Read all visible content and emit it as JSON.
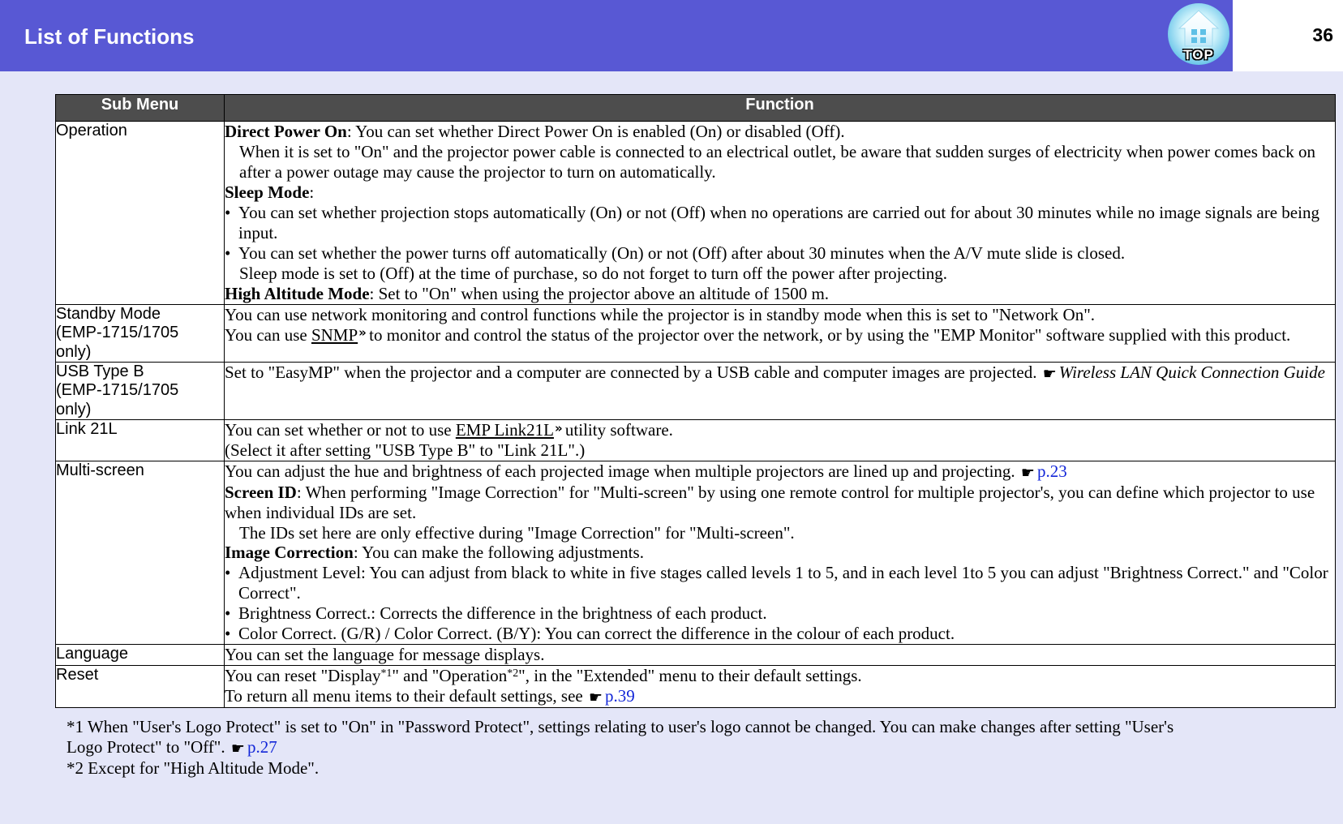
{
  "header": {
    "title": "List of Functions",
    "page_number": "36",
    "top_button_label": "TOP",
    "top_button_icon": "home-icon",
    "bar_color": "#5858d4"
  },
  "table": {
    "columns": [
      "Sub Menu",
      "Function"
    ],
    "rows": [
      {
        "sub_menu": "Operation",
        "blocks": [
          {
            "type": "lead",
            "lead": "Direct Power On",
            "text": ": You can set whether Direct Power On is enabled (On) or disabled (Off)."
          },
          {
            "type": "indent",
            "text": "When it is set to \"On\" and the projector power cable is connected to an electrical outlet, be aware that sudden surges of electricity when power comes back on after a power outage may cause the projector to turn on automatically."
          },
          {
            "type": "lead",
            "lead": "Sleep Mode",
            "text": ":"
          },
          {
            "type": "bullet",
            "text": "You can set whether projection stops automatically (On) or not (Off) when no operations are carried out for about 30 minutes while no image signals are being input."
          },
          {
            "type": "bullet",
            "text": "You can set whether the power turns off automatically (On) or not (Off) after about 30 minutes when the A/V mute slide is closed."
          },
          {
            "type": "indent",
            "text": "Sleep mode is set to (Off) at the time of purchase, so do not forget to turn off the power after projecting."
          },
          {
            "type": "lead",
            "lead": "High Altitude Mode",
            "text": ": Set to \"On\" when using the projector above an altitude of 1500 m."
          }
        ]
      },
      {
        "sub_menu": "Standby Mode\n(EMP-1715/1705\nonly)",
        "blocks": [
          {
            "type": "plain",
            "text": "You can use network monitoring and control functions while the projector is in standby mode when this is set to \"Network On\"."
          },
          {
            "type": "gloss",
            "pre": "You can use ",
            "term": "SNMP",
            "post": " to monitor and control the status of the projector over the network, or by using the \"EMP Monitor\" software supplied with this product."
          }
        ]
      },
      {
        "sub_menu": "USB Type B\n(EMP-1715/1705\nonly)",
        "blocks": [
          {
            "type": "guide",
            "text": "Set to \"EasyMP\" when the projector and a computer are connected by a USB cable and computer images are projected. ",
            "guide_title": "Wireless LAN Quick Connection Guide"
          }
        ]
      },
      {
        "sub_menu": "Link 21L",
        "blocks": [
          {
            "type": "gloss",
            "pre": "You can set whether or not to use ",
            "term": "EMP Link21L",
            "post": " utility software."
          },
          {
            "type": "plain",
            "text": "(Select it after setting \"USB Type B\" to \"Link 21L\".)"
          }
        ]
      },
      {
        "sub_menu": "Multi-screen",
        "blocks": [
          {
            "type": "plink",
            "text": "You can adjust the hue and brightness of each projected image when multiple projectors are lined up and projecting. ",
            "link": "p.23"
          },
          {
            "type": "lead",
            "lead": "Screen ID",
            "text": ": When performing \"Image Correction\" for \"Multi-screen\" by using one remote control for multiple projector's, you can define which projector to use when individual IDs are set."
          },
          {
            "type": "indent",
            "text": "The IDs set here are only effective during \"Image Correction\" for \"Multi-screen\"."
          },
          {
            "type": "lead",
            "lead": "Image Correction",
            "text": ": You can make the following adjustments."
          },
          {
            "type": "bullet",
            "text": "Adjustment Level: You can adjust from black to white in five stages called levels 1 to 5, and in each level 1to 5 you can adjust \"Brightness Correct.\" and \"Color Correct\"."
          },
          {
            "type": "bullet",
            "text": "Brightness Correct.: Corrects the difference in the brightness of each product."
          },
          {
            "type": "bullet",
            "text": "Color Correct. (G/R) / Color Correct. (B/Y): You can correct the difference in the colour of each product."
          }
        ]
      },
      {
        "sub_menu": "Language",
        "blocks": [
          {
            "type": "plain",
            "text": "You can set the language for message displays."
          }
        ]
      },
      {
        "sub_menu": "Reset",
        "blocks": [
          {
            "type": "reset",
            "pre": "You can reset \"Display",
            "sup1": "*1",
            "mid": "\" and \"Operation",
            "sup2": "*2",
            "post": "\", in the \"Extended\" menu to their default settings."
          },
          {
            "type": "plink",
            "text": "To return all menu items to their default settings, see ",
            "link": "p.39"
          }
        ]
      }
    ]
  },
  "footnotes": [
    {
      "marker": "*1",
      "line1": "When \"User's Logo Protect\" is set to \"On\" in \"Password Protect\", settings relating to user's logo cannot be changed. You can make changes after setting \"User's",
      "line2": "Logo Protect\" to \"Off\". ",
      "link": "p.27"
    },
    {
      "marker": "*2",
      "line1": "Except for \"High Altitude Mode\".",
      "line2": "",
      "link": ""
    }
  ],
  "icons": {
    "hand": "☛",
    "gloss_arrow": "»"
  },
  "colors": {
    "page_background": "#e4e6f8",
    "header_bar": "#5858d4",
    "table_header": "#4d4d4d",
    "link_blue": "#1226d8"
  }
}
